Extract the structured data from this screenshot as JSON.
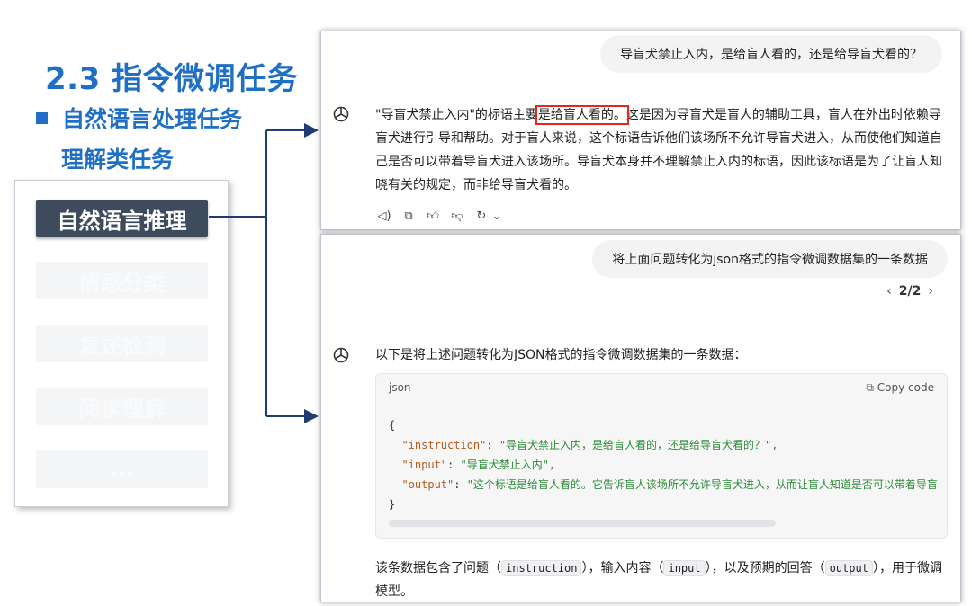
{
  "slide": {
    "title": "2.3 指令微调任务",
    "bullet": "自然语言处理任务",
    "sub_bullet": "理解类任务"
  },
  "tasks": [
    {
      "label": "自然语言推理",
      "active": true
    },
    {
      "label": "情感分类",
      "active": false
    },
    {
      "label": "复述检测",
      "active": false
    },
    {
      "label": "阅读理解",
      "active": false
    },
    {
      "label": "...",
      "active": false
    }
  ],
  "chat1": {
    "user_message": "导盲犬禁止入内，是给盲人看的，还是给导盲犬看的？",
    "answer_before": "\"导盲犬禁止入内\"的标语主要",
    "answer_highlight": "是给盲人看的。",
    "answer_after": "这是因为导盲犬是盲人的辅助工具，盲人在外出时依赖导盲犬进行引导和帮助。对于盲人来说，这个标语告诉他们该场所不允许导盲犬进入，从而使他们知道自己是否可以带着导盲犬进入该场所。导盲犬本身并不理解禁止入内的标语，因此该标语是为了让盲人知晓有关的规定，而非给导盲犬看的。"
  },
  "chat2": {
    "user_message": "将上面问题转化为json格式的指令微调数据集的一条数据",
    "pager": {
      "prev": "‹",
      "current": "2/2",
      "next": "›"
    },
    "answer_intro": "以下是将上述问题转化为JSON格式的指令微调数据集的一条数据：",
    "code": {
      "lang": "json",
      "copy_label": "Copy code",
      "open_brace": "{",
      "close_brace": "}",
      "lines": [
        {
          "key": "\"instruction\"",
          "value": "\"导盲犬禁止入内，是给盲人看的，还是给导盲犬看的？\","
        },
        {
          "key": "\"input\"",
          "value": "\"导盲犬禁止入内\","
        },
        {
          "key": "\"output\"",
          "value": "\"这个标语是给盲人看的。它告诉盲人该场所不允许导盲犬进入，从而让盲人知道是否可以带着导盲"
        }
      ]
    },
    "final": {
      "p1": "该条数据包含了问题（",
      "c1": "instruction",
      "p2": "），输入内容（",
      "c2": "input",
      "p3": "），以及预期的回答（",
      "c3": "output",
      "p4": "），用于微调模型。"
    }
  },
  "colors": {
    "title_blue": "#1f6fc4",
    "active_task_bg": "#3d4b5c",
    "highlight_red": "#e0281e",
    "connector_navy": "#1f3d73"
  },
  "icons": [
    "openai-logo-icon",
    "speaker-icon",
    "copy-icon",
    "thumbs-up-icon",
    "thumbs-down-icon",
    "regenerate-icon",
    "chevron-down-icon",
    "chevron-left-icon",
    "chevron-right-icon",
    "clipboard-icon"
  ]
}
